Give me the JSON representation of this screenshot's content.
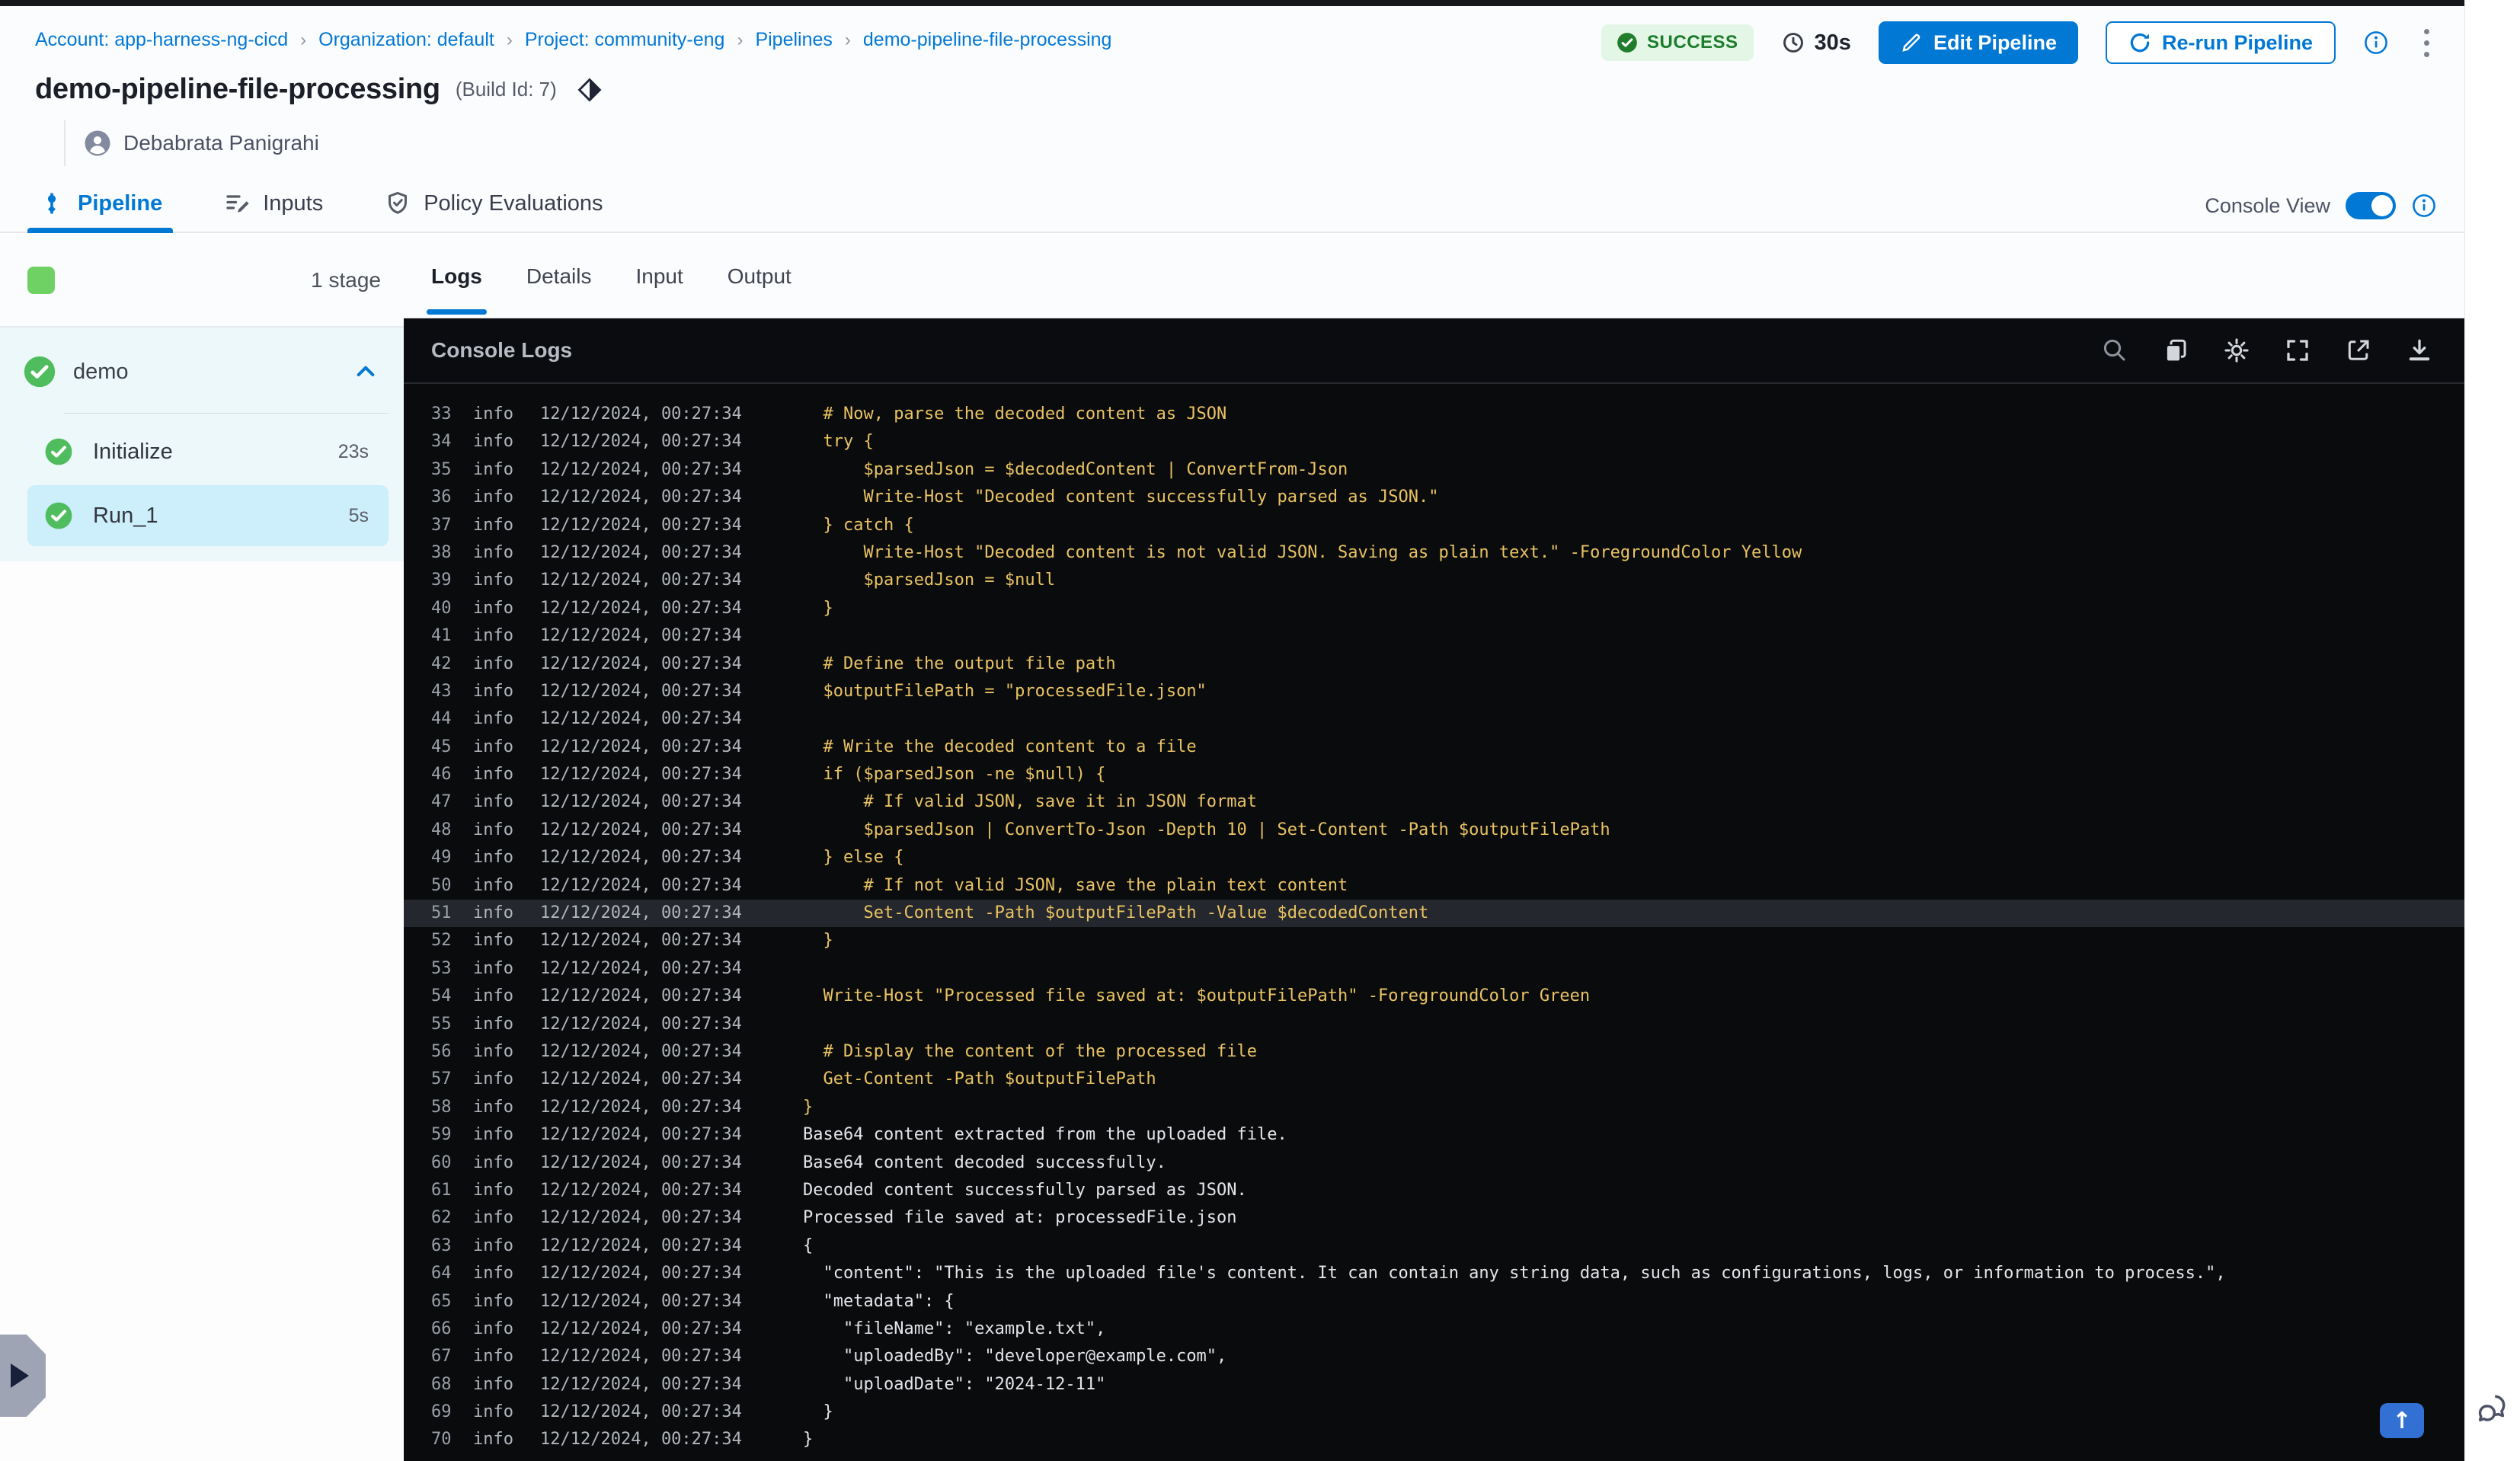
{
  "breadcrumb": {
    "separator": "›",
    "items": [
      "Account: app-harness-ng-cicd",
      "Organization: default",
      "Project: community-eng",
      "Pipelines",
      "demo-pipeline-file-processing"
    ]
  },
  "status": {
    "label": "SUCCESS",
    "duration": "30s"
  },
  "actions": {
    "edit": "Edit Pipeline",
    "rerun": "Re-run Pipeline"
  },
  "title": {
    "name": "demo-pipeline-file-processing",
    "build": "(Build Id: 7)",
    "author": "Debabrata Panigrahi"
  },
  "main_tabs": [
    {
      "label": "Pipeline",
      "active": true
    },
    {
      "label": "Inputs",
      "active": false
    },
    {
      "label": "Policy Evaluations",
      "active": false
    }
  ],
  "console_view": {
    "label": "Console View",
    "enabled": true
  },
  "sidebar": {
    "stage_count": "1 stage",
    "group": {
      "name": "demo"
    },
    "steps": [
      {
        "name": "Initialize",
        "duration": "23s",
        "selected": false
      },
      {
        "name": "Run_1",
        "duration": "5s",
        "selected": true
      }
    ]
  },
  "console": {
    "tabs": [
      {
        "label": "Logs",
        "active": true
      },
      {
        "label": "Details",
        "active": false
      },
      {
        "label": "Input",
        "active": false
      },
      {
        "label": "Output",
        "active": false
      }
    ],
    "title": "Console Logs",
    "toolbar_icons": [
      "search-icon",
      "copy-icon",
      "settings-icon",
      "fullscreen-icon",
      "open-in-new-icon",
      "download-icon"
    ],
    "log_level": "info",
    "log_time": "12/12/2024, 00:27:34",
    "logs": [
      {
        "n": 33,
        "text": "  # Now, parse the decoded content as JSON",
        "type": "script"
      },
      {
        "n": 34,
        "text": "  try {",
        "type": "script"
      },
      {
        "n": 35,
        "text": "      $parsedJson = $decodedContent | ConvertFrom-Json",
        "type": "script"
      },
      {
        "n": 36,
        "text": "      Write-Host \"Decoded content successfully parsed as JSON.\"",
        "type": "script"
      },
      {
        "n": 37,
        "text": "  } catch {",
        "type": "script"
      },
      {
        "n": 38,
        "text": "      Write-Host \"Decoded content is not valid JSON. Saving as plain text.\" -ForegroundColor Yellow",
        "type": "script"
      },
      {
        "n": 39,
        "text": "      $parsedJson = $null",
        "type": "script"
      },
      {
        "n": 40,
        "text": "  }",
        "type": "script"
      },
      {
        "n": 41,
        "text": "",
        "type": "script"
      },
      {
        "n": 42,
        "text": "  # Define the output file path",
        "type": "script"
      },
      {
        "n": 43,
        "text": "  $outputFilePath = \"processedFile.json\"",
        "type": "script"
      },
      {
        "n": 44,
        "text": "",
        "type": "script"
      },
      {
        "n": 45,
        "text": "  # Write the decoded content to a file",
        "type": "script"
      },
      {
        "n": 46,
        "text": "  if ($parsedJson -ne $null) {",
        "type": "script"
      },
      {
        "n": 47,
        "text": "      # If valid JSON, save it in JSON format",
        "type": "script"
      },
      {
        "n": 48,
        "text": "      $parsedJson | ConvertTo-Json -Depth 10 | Set-Content -Path $outputFilePath",
        "type": "script"
      },
      {
        "n": 49,
        "text": "  } else {",
        "type": "script"
      },
      {
        "n": 50,
        "text": "      # If not valid JSON, save the plain text content",
        "type": "script"
      },
      {
        "n": 51,
        "text": "      Set-Content -Path $outputFilePath -Value $decodedContent",
        "type": "script",
        "hl": true
      },
      {
        "n": 52,
        "text": "  }",
        "type": "script"
      },
      {
        "n": 53,
        "text": "",
        "type": "script"
      },
      {
        "n": 54,
        "text": "  Write-Host \"Processed file saved at: $outputFilePath\" -ForegroundColor Green",
        "type": "script"
      },
      {
        "n": 55,
        "text": "",
        "type": "script"
      },
      {
        "n": 56,
        "text": "  # Display the content of the processed file",
        "type": "script"
      },
      {
        "n": 57,
        "text": "  Get-Content -Path $outputFilePath",
        "type": "script"
      },
      {
        "n": 58,
        "text": "}",
        "type": "script"
      },
      {
        "n": 59,
        "text": "Base64 content extracted from the uploaded file.",
        "type": "output"
      },
      {
        "n": 60,
        "text": "Base64 content decoded successfully.",
        "type": "output"
      },
      {
        "n": 61,
        "text": "Decoded content successfully parsed as JSON.",
        "type": "output"
      },
      {
        "n": 62,
        "text": "Processed file saved at: processedFile.json",
        "type": "output"
      },
      {
        "n": 63,
        "text": "{",
        "type": "output"
      },
      {
        "n": 64,
        "text": "  \"content\": \"This is the uploaded file's content. It can contain any string data, such as configurations, logs, or information to process.\",",
        "type": "output"
      },
      {
        "n": 65,
        "text": "  \"metadata\": {",
        "type": "output"
      },
      {
        "n": 66,
        "text": "    \"fileName\": \"example.txt\",",
        "type": "output"
      },
      {
        "n": 67,
        "text": "    \"uploadedBy\": \"developer@example.com\",",
        "type": "output"
      },
      {
        "n": 68,
        "text": "    \"uploadDate\": \"2024-12-11\"",
        "type": "output"
      },
      {
        "n": 69,
        "text": "  }",
        "type": "output"
      },
      {
        "n": 70,
        "text": "}",
        "type": "output"
      }
    ]
  },
  "colors": {
    "primary": "#0278d5",
    "success_badge_bg": "#e4f6e6",
    "success_badge_text": "#1b7d2c",
    "stage_green": "#4fbd5e",
    "log_script": "#e9c363",
    "log_output": "#e3e5e9",
    "console_bg": "#0a0b0d",
    "selected_step_bg": "#cdeefb"
  }
}
